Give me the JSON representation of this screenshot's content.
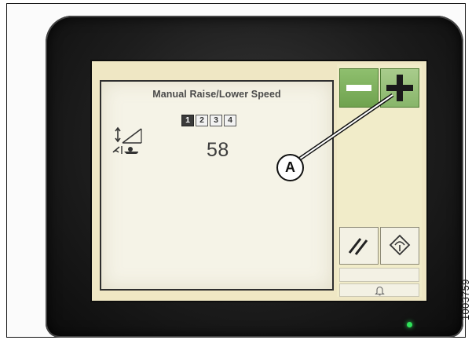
{
  "screen": {
    "title": "Manual Raise/Lower Speed",
    "speed_options": [
      "1",
      "2",
      "3",
      "4"
    ],
    "selected_speed_index": 0,
    "speed_value": "58"
  },
  "callout": {
    "label": "A"
  },
  "figure_id": "1003759",
  "icons": {
    "header_icon": "header-height-angle-icon",
    "minus": "minus-icon",
    "plus": "plus-icon",
    "float": "float-slash-icon",
    "tilt": "header-tilt-icon",
    "alert": "alert-bell-icon"
  },
  "colors": {
    "screen_background": "#efe7c4",
    "button_green": "#7caf5a",
    "indicator_led": "#2fe35a"
  }
}
